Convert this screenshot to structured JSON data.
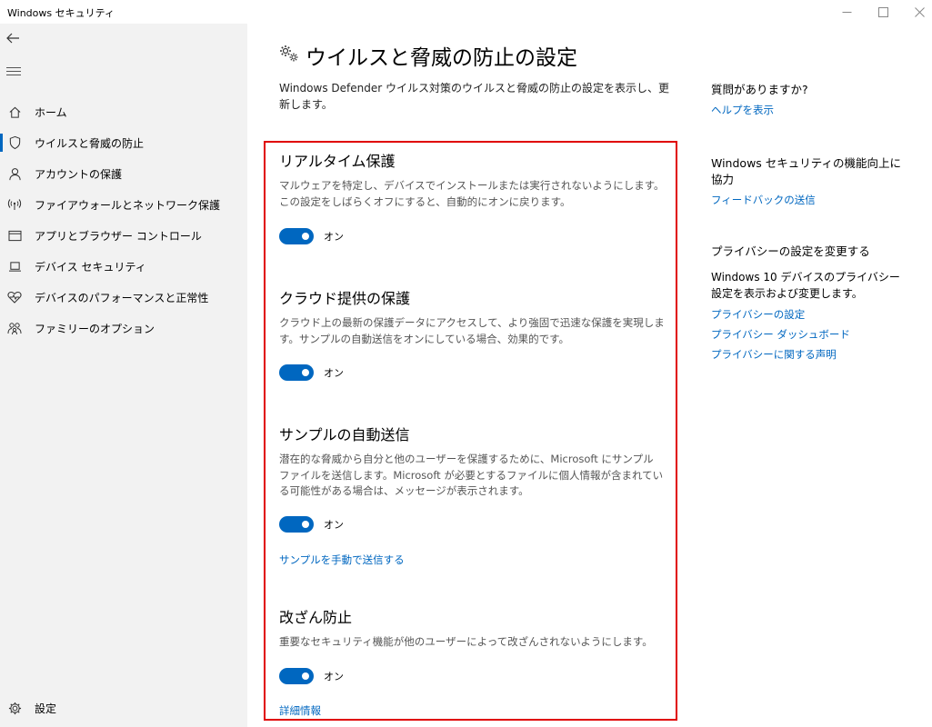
{
  "window": {
    "title": "Windows セキュリティ",
    "minimize": "—",
    "maximize": "☐",
    "close": "✕"
  },
  "sidebar": {
    "items": [
      {
        "label": "ホーム",
        "icon": "home-icon"
      },
      {
        "label": "ウイルスと脅威の防止",
        "icon": "shield-icon",
        "active": true
      },
      {
        "label": "アカウントの保護",
        "icon": "person-icon"
      },
      {
        "label": "ファイアウォールとネットワーク保護",
        "icon": "wifi-icon"
      },
      {
        "label": "アプリとブラウザー コントロール",
        "icon": "app-window-icon"
      },
      {
        "label": "デバイス セキュリティ",
        "icon": "laptop-icon"
      },
      {
        "label": "デバイスのパフォーマンスと正常性",
        "icon": "heart-pulse-icon"
      },
      {
        "label": "ファミリーのオプション",
        "icon": "family-icon"
      }
    ],
    "settings_label": "設定"
  },
  "main": {
    "title": "ウイルスと脅威の防止の設定",
    "description": "Windows Defender ウイルス対策のウイルスと脅威の防止の設定を表示し、更新します。",
    "sections": [
      {
        "title": "リアルタイム保護",
        "description": "マルウェアを特定し、デバイスでインストールまたは実行されないようにします。この設定をしばらくオフにすると、自動的にオンに戻ります。",
        "toggle_label": "オン",
        "toggle_on": true
      },
      {
        "title": "クラウド提供の保護",
        "description": "クラウド上の最新の保護データにアクセスして、より強固で迅速な保護を実現します。サンプルの自動送信をオンにしている場合、効果的です。",
        "toggle_label": "オン",
        "toggle_on": true
      },
      {
        "title": "サンプルの自動送信",
        "description": "潜在的な脅威から自分と他のユーザーを保護するために、Microsoft にサンプル ファイルを送信します。Microsoft が必要とするファイルに個人情報が含まれている可能性がある場合は、メッセージが表示されます。",
        "toggle_label": "オン",
        "toggle_on": true,
        "link": "サンプルを手動で送信する"
      },
      {
        "title": "改ざん防止",
        "description": "重要なセキュリティ機能が他のユーザーによって改ざんされないようにします。",
        "toggle_label": "オン",
        "toggle_on": true,
        "link": "詳細情報"
      }
    ]
  },
  "right_panel": {
    "question_title": "質問がありますか?",
    "help_link": "ヘルプを表示",
    "improve_title": "Windows セキュリティの機能向上に協力",
    "feedback_link": "フィードバックの送信",
    "privacy_title": "プライバシーの設定を変更する",
    "privacy_text": "Windows 10 デバイスのプライバシー設定を表示および変更します。",
    "privacy_links": [
      "プライバシーの設定",
      "プライバシー ダッシュボード",
      "プライバシーに関する声明"
    ]
  },
  "colors": {
    "accent": "#0067c0",
    "highlight_border": "#e00000",
    "sidebar_bg": "#f2f2f2"
  }
}
